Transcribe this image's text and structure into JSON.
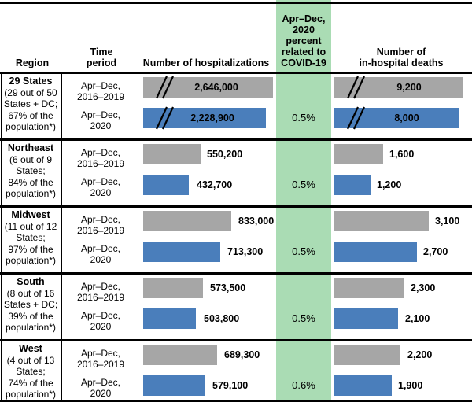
{
  "header": {
    "region": "Region",
    "time_period": "Time\nperiod",
    "hospitalizations": "Number of hospitalizations",
    "percent": "Apr–Dec,\n2020\npercent\nrelated to\nCOVID-19",
    "deaths": "Number of\nin-hospital deaths"
  },
  "labels": {
    "period_baseline": "Apr–Dec,\n2016–2019",
    "period_2020": "Apr–Dec,\n2020"
  },
  "colors": {
    "baseline_bar": "#A6A6A6",
    "pandemic_bar": "#4A7EBB",
    "percent_band": "#AADCB4",
    "rule": "#000000",
    "text": "#000000"
  },
  "chart_data": {
    "type": "bar",
    "title": "",
    "orientation": "horizontal",
    "grid": false,
    "legend": "none",
    "axis_break_rows": [
      "29 States"
    ],
    "categories": [
      "29 States",
      "Northeast",
      "Midwest",
      "South",
      "West"
    ],
    "series": [
      {
        "name": "Apr–Dec, 2016–2019",
        "color": "#A6A6A6",
        "hospitalizations": [
          2646000,
          550200,
          833000,
          573500,
          689300
        ],
        "deaths": [
          9200,
          1600,
          3100,
          2300,
          2200
        ]
      },
      {
        "name": "Apr–Dec, 2020",
        "color": "#4A7EBB",
        "hospitalizations": [
          2228900,
          432700,
          713300,
          503800,
          579100
        ],
        "deaths": [
          8000,
          1200,
          2700,
          2100,
          1900
        ]
      }
    ],
    "percent_covid_related": [
      "0.5%",
      "0.5%",
      "0.5%",
      "0.5%",
      "0.6%"
    ]
  },
  "rows": [
    {
      "region_name": "29 States",
      "region_detail": "(29 out of 50\nStates + DC;\n67% of the\npopulation*)",
      "period_baseline": "Apr–Dec,\n2016–2019",
      "period_2020": "Apr–Dec,\n2020",
      "hosp_baseline": "2,646,000",
      "hosp_2020": "2,228,900",
      "percent": "0.5%",
      "deaths_baseline": "9,200",
      "deaths_2020": "8,000"
    },
    {
      "region_name": "Northeast",
      "region_detail": "(6 out of 9\nStates;\n84% of the\npopulation*)",
      "period_baseline": "Apr–Dec,\n2016–2019",
      "period_2020": "Apr–Dec,\n2020",
      "hosp_baseline": "550,200",
      "hosp_2020": "432,700",
      "percent": "0.5%",
      "deaths_baseline": "1,600",
      "deaths_2020": "1,200"
    },
    {
      "region_name": "Midwest",
      "region_detail": "(11 out of 12\nStates;\n97% of the\npopulation*)",
      "period_baseline": "Apr–Dec,\n2016–2019",
      "period_2020": "Apr–Dec,\n2020",
      "hosp_baseline": "833,000",
      "hosp_2020": "713,300",
      "percent": "0.5%",
      "deaths_baseline": "3,100",
      "deaths_2020": "2,700"
    },
    {
      "region_name": "South",
      "region_detail": "(8 out of 16\nStates + DC;\n39% of the\npopulation*)",
      "period_baseline": "Apr–Dec,\n2016–2019",
      "period_2020": "Apr–Dec,\n2020",
      "hosp_baseline": "573,500",
      "hosp_2020": "503,800",
      "percent": "0.5%",
      "deaths_baseline": "2,300",
      "deaths_2020": "2,100"
    },
    {
      "region_name": "West",
      "region_detail": "(4 out of 13\nStates;\n74% of the\npopulation*)",
      "period_baseline": "Apr–Dec,\n2016–2019",
      "period_2020": "Apr–Dec,\n2020",
      "hosp_baseline": "689,300",
      "hosp_2020": "579,100",
      "percent": "0.6%",
      "deaths_baseline": "2,200",
      "deaths_2020": "1,900"
    }
  ]
}
